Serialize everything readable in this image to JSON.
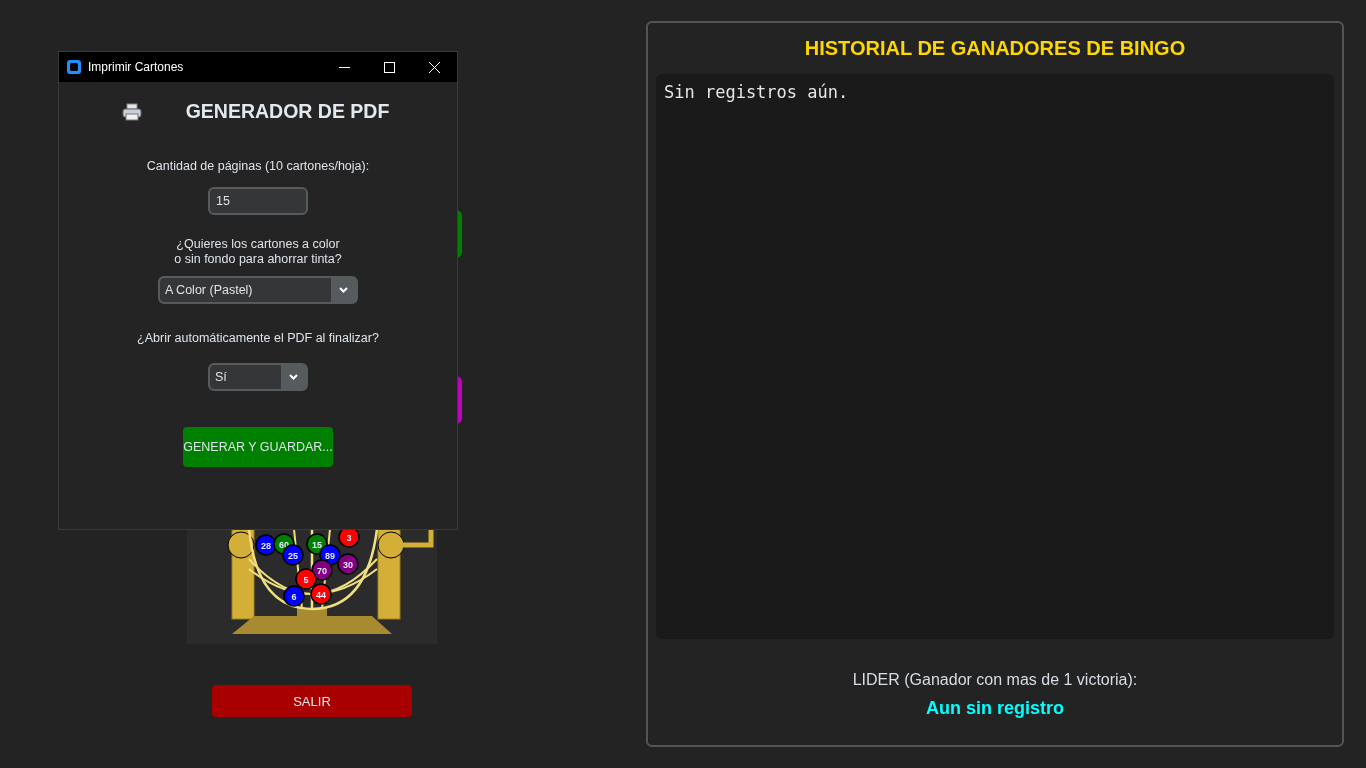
{
  "main_window": {
    "partial_buttons": [
      {
        "color": "#008000"
      },
      {
        "color": "#c000c0"
      }
    ],
    "drum_balls": [
      {
        "number": "28",
        "color": "#0000ff"
      },
      {
        "number": "60",
        "color": "#008000"
      },
      {
        "number": "15",
        "color": "#008000"
      },
      {
        "number": "3",
        "color": "#ff0000"
      },
      {
        "number": "25",
        "color": "#0000ff"
      },
      {
        "number": "89",
        "color": "#0000ff"
      },
      {
        "number": "70",
        "color": "#800080"
      },
      {
        "number": "30",
        "color": "#800080"
      },
      {
        "number": "5",
        "color": "#ff0000"
      },
      {
        "number": "6",
        "color": "#0000ff"
      },
      {
        "number": "44",
        "color": "#ff0000"
      }
    ],
    "exit_button": "SALIR",
    "history": {
      "title": "HISTORIAL DE GANADORES DE BINGO",
      "log": "Sin registros aún.",
      "leader_label": "LIDER (Ganador con mas de 1 victoria):",
      "leader_value": "Aun sin registro"
    }
  },
  "dialog": {
    "title": "Imprimir Cartones",
    "heading": "GENERADOR DE PDF",
    "pages_label": "Cantidad de páginas (10 cartones/hoja):",
    "pages_value": "15",
    "color_question": "¿Quieres los cartones a color\no sin fondo para ahorrar tinta?",
    "color_select": "A Color (Pastel)",
    "open_question": "¿Abrir automáticamente el PDF al finalizar?",
    "open_select": "Sí",
    "generate_button": "GENERAR Y GUARDAR..."
  }
}
